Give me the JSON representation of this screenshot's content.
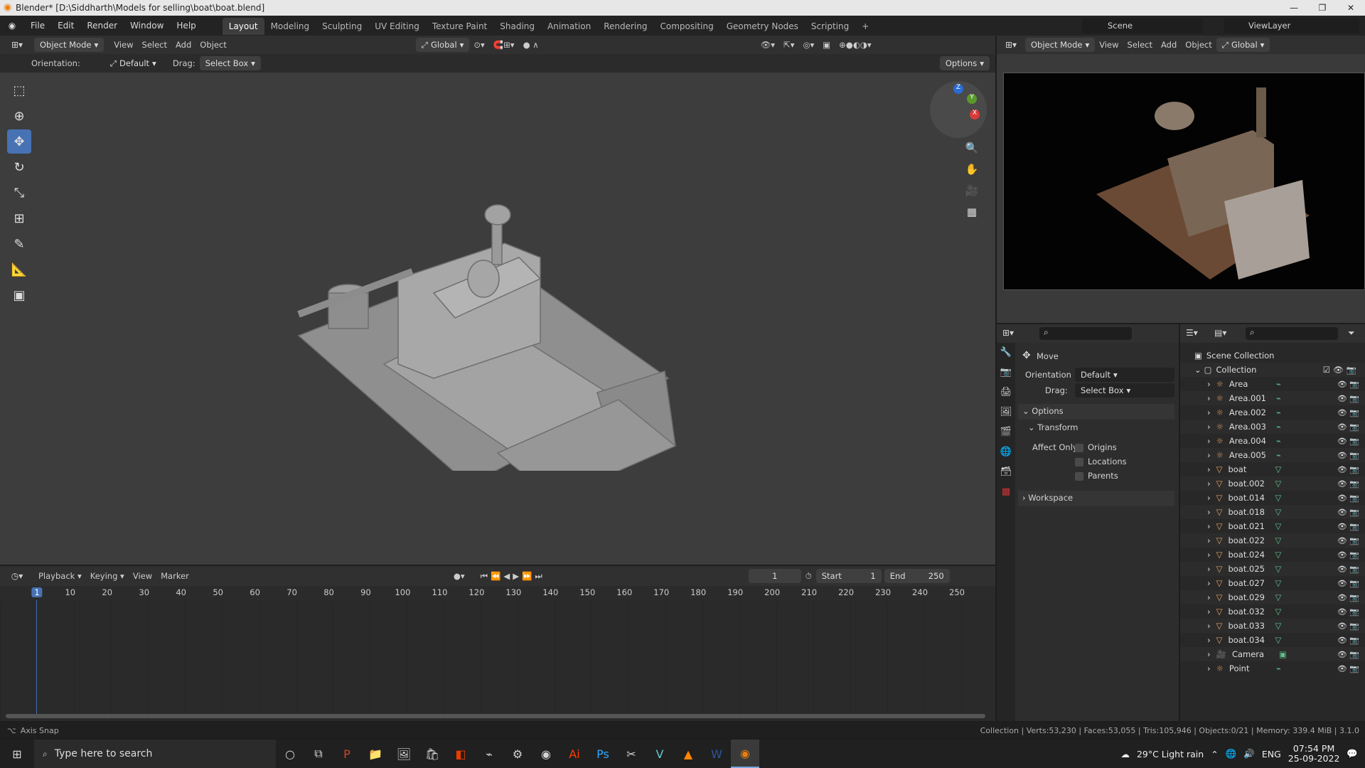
{
  "window": {
    "title": "Blender* [D:\\Siddharth\\Models for selling\\boat\\boat.blend]"
  },
  "menu": [
    "File",
    "Edit",
    "Render",
    "Window",
    "Help"
  ],
  "workspaces": [
    "Layout",
    "Modeling",
    "Sculpting",
    "UV Editing",
    "Texture Paint",
    "Shading",
    "Animation",
    "Rendering",
    "Compositing",
    "Geometry Nodes",
    "Scripting"
  ],
  "scene": {
    "name": "Scene",
    "view_layer": "ViewLayer"
  },
  "viewport_header": {
    "mode": "Object Mode",
    "view": "View",
    "select": "Select",
    "add": "Add",
    "object": "Object",
    "transform": "Global"
  },
  "tool_settings": {
    "orientation_label": "Orientation:",
    "orientation_value": "Default",
    "drag_label": "Drag:",
    "drag_value": "Select Box",
    "options": "Options"
  },
  "right_header": {
    "mode": "Object Mode",
    "view": "View",
    "select": "Select",
    "add": "Add",
    "object": "Object",
    "transform": "Global"
  },
  "timeline": {
    "playback": "Playback",
    "keying": "Keying",
    "view": "View",
    "marker": "Marker",
    "current_frame": "1",
    "start_label": "Start",
    "start": "1",
    "end_label": "End",
    "end": "250",
    "ticks": [
      "1",
      "10",
      "20",
      "30",
      "40",
      "50",
      "60",
      "70",
      "80",
      "90",
      "100",
      "110",
      "120",
      "130",
      "140",
      "150",
      "160",
      "170",
      "180",
      "190",
      "200",
      "210",
      "220",
      "230",
      "240",
      "250"
    ]
  },
  "properties": {
    "tool_title": "Move",
    "orientation_label": "Orientation",
    "orientation_value": "Default",
    "drag_label": "Drag:",
    "drag_value": "Select Box",
    "options": "Options",
    "transform": "Transform",
    "affect_only": "Affect Only",
    "checks": [
      "Origins",
      "Locations",
      "Parents"
    ],
    "workspace": "Workspace"
  },
  "outliner": {
    "scene_collection": "Scene Collection",
    "collection": "Collection",
    "items": [
      {
        "name": "Area",
        "type": "light"
      },
      {
        "name": "Area.001",
        "type": "light"
      },
      {
        "name": "Area.002",
        "type": "light"
      },
      {
        "name": "Area.003",
        "type": "light"
      },
      {
        "name": "Area.004",
        "type": "light"
      },
      {
        "name": "Area.005",
        "type": "light"
      },
      {
        "name": "boat",
        "type": "mesh"
      },
      {
        "name": "boat.002",
        "type": "mesh"
      },
      {
        "name": "boat.014",
        "type": "mesh"
      },
      {
        "name": "boat.018",
        "type": "mesh"
      },
      {
        "name": "boat.021",
        "type": "mesh"
      },
      {
        "name": "boat.022",
        "type": "mesh"
      },
      {
        "name": "boat.024",
        "type": "mesh"
      },
      {
        "name": "boat.025",
        "type": "mesh"
      },
      {
        "name": "boat.027",
        "type": "mesh"
      },
      {
        "name": "boat.029",
        "type": "mesh"
      },
      {
        "name": "boat.032",
        "type": "mesh"
      },
      {
        "name": "boat.033",
        "type": "mesh"
      },
      {
        "name": "boat.034",
        "type": "mesh"
      },
      {
        "name": "Camera",
        "type": "camera"
      },
      {
        "name": "Point",
        "type": "light"
      }
    ]
  },
  "status": {
    "left": "Axis Snap",
    "right": "Collection | Verts:53,230 | Faces:53,055 | Tris:105,946 | Objects:0/21 | Memory: 339.4 MiB | 3.1.0"
  },
  "taskbar": {
    "search_placeholder": "Type here to search",
    "weather": "29°C  Light rain",
    "lang": "ENG",
    "time": "07:54 PM",
    "date": "25-09-2022"
  }
}
